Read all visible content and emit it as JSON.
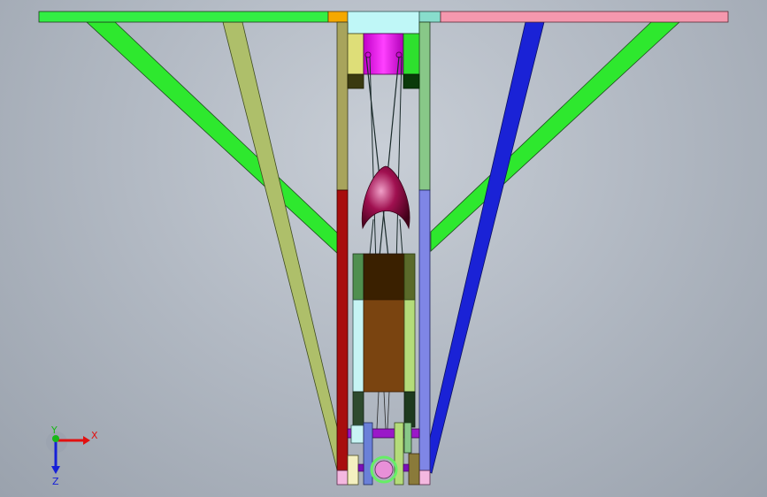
{
  "viewport": {
    "background_top": "#c8ced6",
    "background_bottom": "#9aa2ad"
  },
  "palette": {
    "top_bar_left": "#33ee44",
    "top_bar_right": "#f598ae",
    "top_block_orange": "#f5a800",
    "top_block_cyan": "#bff7f7",
    "top_block_teal": "#88ddcc",
    "diagonal_strut_green": "#2ee82e",
    "diagonal_strut_olive": "#aebf6a",
    "diagonal_strut_blue": "#1a22d6",
    "left_rail_upper": "#a8a45c",
    "left_rail_lower": "#a80e0e",
    "right_rail_upper": "#88c888",
    "right_rail_lower": "#7f86e6",
    "motor_magenta": "#e014e8",
    "pivot_block_yellow": "#dede78",
    "pivot_block_green": "#2ee02e",
    "cam_crimson": "#a01050",
    "slider_dark": "#3a2000",
    "slider_brown": "#7a4410",
    "slider_side_green": "#4f8f4f",
    "slider_side_cyan": "#c6f4f4",
    "slider_side_lime": "#b4dc7a",
    "base_pink": "#f4b8e0",
    "base_cream": "#f4f0c0",
    "base_gear_pink": "#e890d8",
    "base_ring_green": "#66ee66"
  },
  "triad": {
    "x_label": "X",
    "y_label": "Y",
    "z_label": "Z",
    "x_color": "#e21010",
    "y_color": "#18b818",
    "z_color": "#1620d8"
  }
}
